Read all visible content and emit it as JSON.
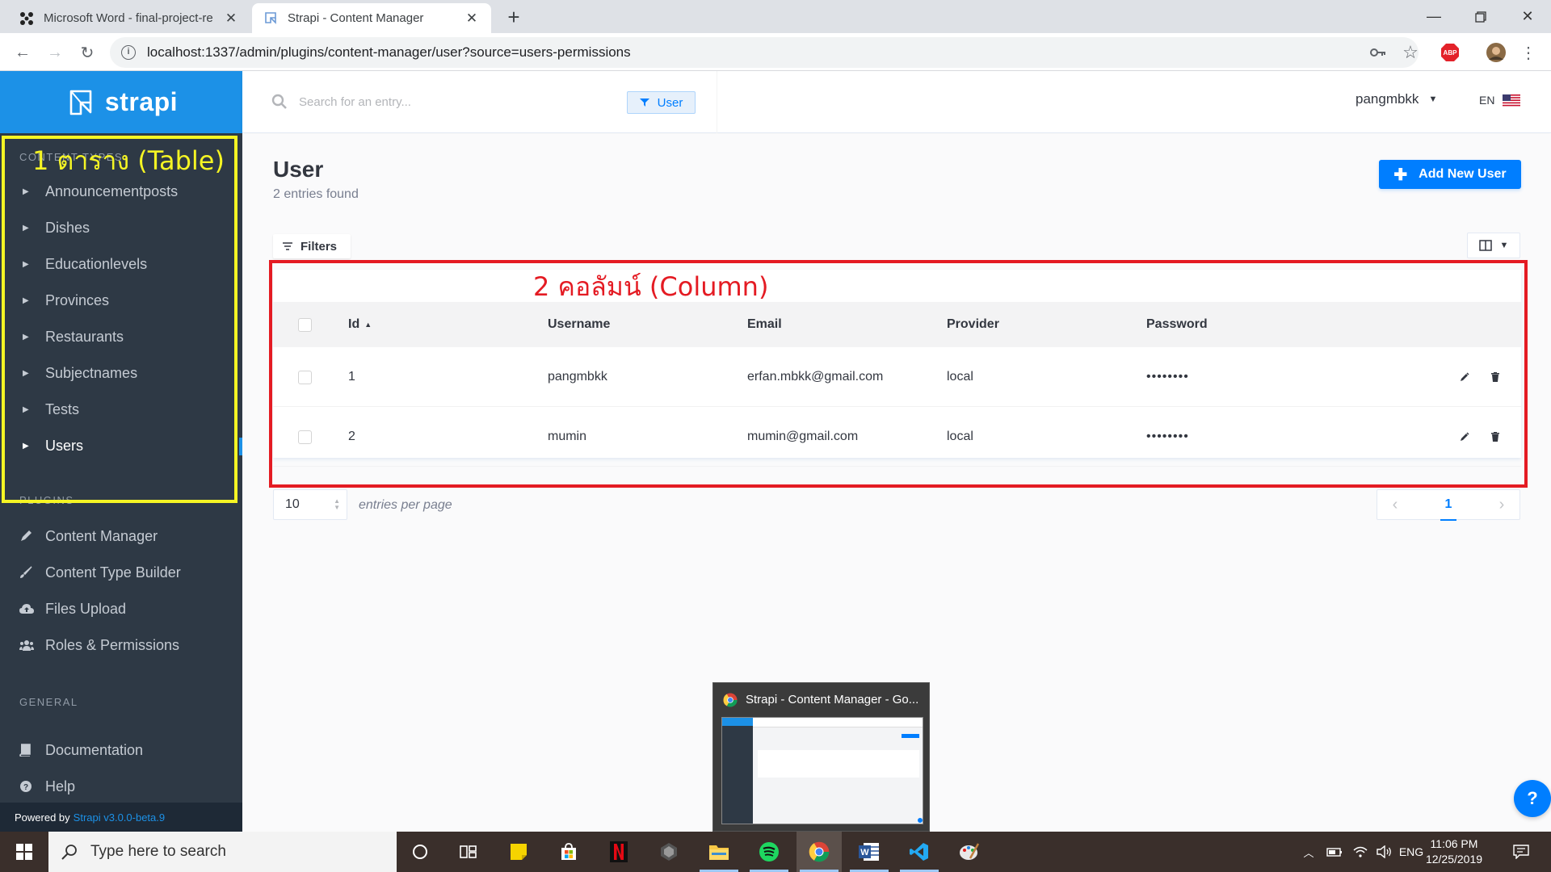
{
  "browser": {
    "tabs": [
      {
        "title": "Microsoft Word - final-project-re",
        "active": false
      },
      {
        "title": "Strapi - Content Manager",
        "active": true
      }
    ],
    "url": "localhost:1337/admin/plugins/content-manager/user?source=users-permissions",
    "extension_badge": "ABP"
  },
  "sidebar": {
    "brand": "strapi",
    "content_section_title": "CONTENT TYPES",
    "content_items": [
      {
        "label": "Announcementposts"
      },
      {
        "label": "Dishes"
      },
      {
        "label": "Educationlevels"
      },
      {
        "label": "Provinces"
      },
      {
        "label": "Restaurants"
      },
      {
        "label": "Subjectnames"
      },
      {
        "label": "Tests"
      },
      {
        "label": "Users",
        "active": true
      }
    ],
    "plugins_section_title": "PLUGINS",
    "plugin_items": [
      {
        "label": "Content Manager",
        "icon": "pen-icon"
      },
      {
        "label": "Content Type Builder",
        "icon": "brush-icon"
      },
      {
        "label": "Files Upload",
        "icon": "cloud-upload-icon"
      },
      {
        "label": "Roles & Permissions",
        "icon": "users-icon"
      }
    ],
    "general_section_title": "GENERAL",
    "general_items": [
      {
        "label": "Documentation",
        "icon": "book-icon"
      },
      {
        "label": "Help",
        "icon": "question-circle-icon"
      }
    ],
    "powered_by": "Powered by",
    "version": "Strapi v3.0.0-beta.9"
  },
  "header": {
    "search_placeholder": "Search for an entry...",
    "filter_chip": "User",
    "username": "pangmbkk",
    "language": "EN"
  },
  "main": {
    "title": "User",
    "subtitle": "2 entries found",
    "add_button": "Add New User",
    "filters_button": "Filters",
    "table": {
      "headers": [
        "Id",
        "Username",
        "Email",
        "Provider",
        "Password"
      ],
      "rows": [
        {
          "id": "1",
          "username": "pangmbkk",
          "email": "erfan.mbkk@gmail.com",
          "provider": "local",
          "password": "••••••••"
        },
        {
          "id": "2",
          "username": "mumin",
          "email": "mumin@gmail.com",
          "provider": "local",
          "password": "••••••••"
        }
      ]
    },
    "per_page_value": "10",
    "per_page_label": "entries per page",
    "current_page": "1",
    "help_button": "?"
  },
  "annotations": {
    "yellow_label": "1   ตาราง (Table)",
    "red_label": "2 คอลัมน์ (Column)",
    "yellow_color": "#f5f524",
    "red_color": "#e41b23"
  },
  "taskbar": {
    "search_placeholder": "Type here to search",
    "preview_title": "Strapi - Content Manager - Go...",
    "language": "ENG",
    "time": "11:06 PM",
    "date": "12/25/2019"
  },
  "colors": {
    "strapi_blue": "#007eff",
    "sidebar_bg": "#2e3945",
    "brand_bg": "#1c91e7"
  }
}
